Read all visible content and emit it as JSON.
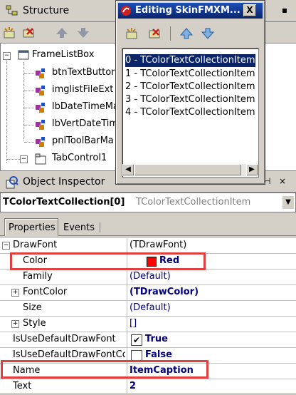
{
  "structure": {
    "title": "Structure",
    "tree": [
      {
        "label": "FrameListBox"
      },
      {
        "label": "btnTextButtor"
      },
      {
        "label": "imglistFileExt"
      },
      {
        "label": "lbDateTimeMa"
      },
      {
        "label": "lbVertDateTim"
      },
      {
        "label": "pnlToolBarMa"
      },
      {
        "label": "TabControl1"
      }
    ]
  },
  "editor": {
    "title": "Editing SkinFMXM...",
    "close_label": "X",
    "items": [
      "0 - TColorTextCollectionItem",
      "1 - TColorTextCollectionItem",
      "2 - TColorTextCollectionItem",
      "3 - TColorTextCollectionItem",
      "4 - TColorTextCollectionItem"
    ]
  },
  "inspector": {
    "title": "Object Inspector",
    "object_name": "TColorTextCollection[0]",
    "object_type": "TColorTextCollectionItem",
    "tabs": [
      "Properties",
      "Events"
    ],
    "rows": [
      {
        "name": "DrawFont",
        "value": "(TDrawFont)",
        "expander": "-"
      },
      {
        "name": "Color",
        "value": "Red"
      },
      {
        "name": "Family",
        "value": "(Default)"
      },
      {
        "name": "FontColor",
        "value": "(TDrawColor)",
        "expander": "+"
      },
      {
        "name": "Size",
        "value": "(Default)"
      },
      {
        "name": "Style",
        "value": "[]",
        "expander": "+"
      },
      {
        "name": "IsUseDefaultDrawFont",
        "value": "True"
      },
      {
        "name": "IsUseDefaultDrawFontCo",
        "value": "False"
      },
      {
        "name": "Name",
        "value": "ItemCaption"
      },
      {
        "name": "Text",
        "value": "2"
      }
    ]
  },
  "colors": {
    "highlight": "#e04040",
    "selection": "#0a246a",
    "titlebar": "#0a246a",
    "color_swatch": "#ff0000"
  }
}
